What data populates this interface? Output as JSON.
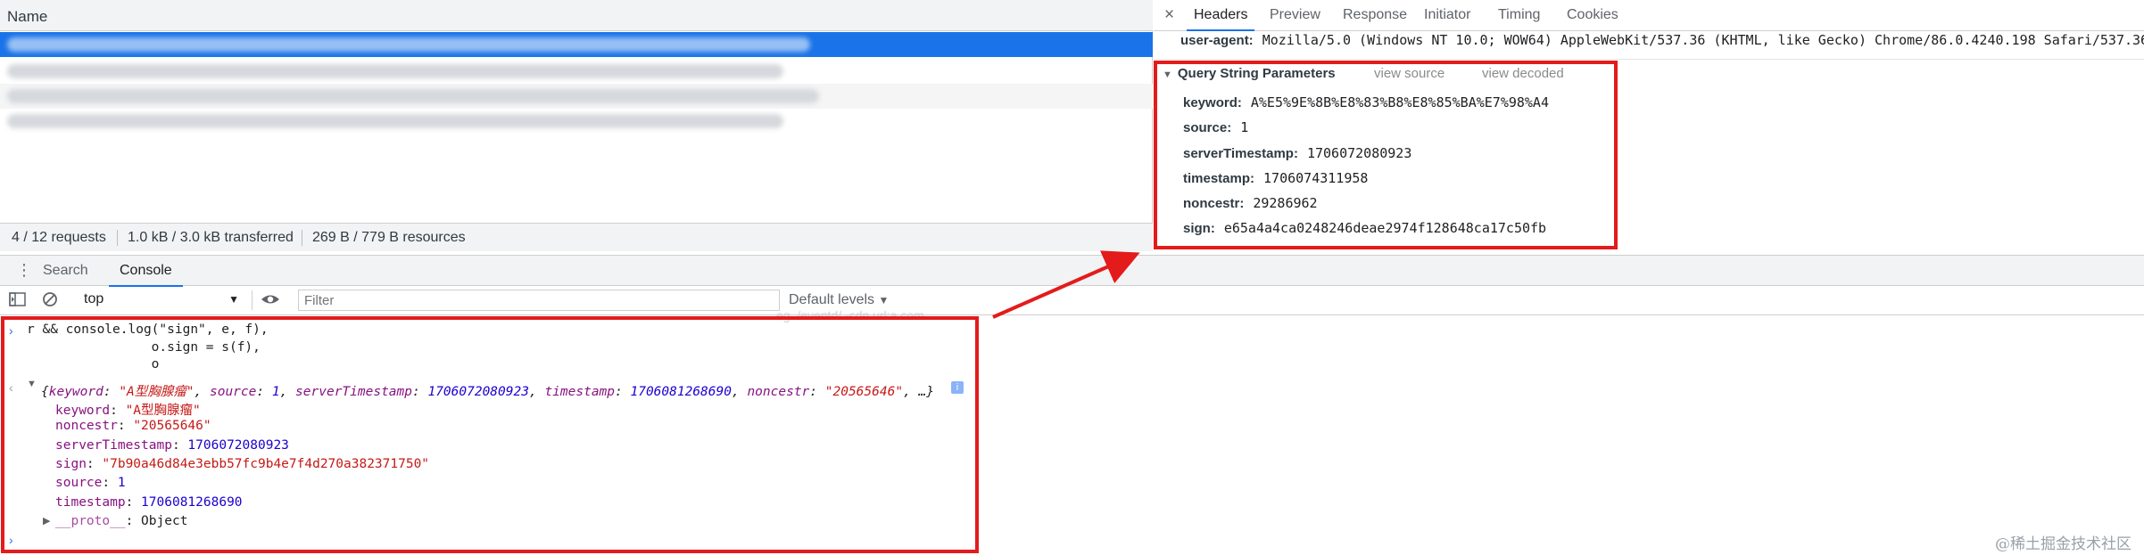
{
  "network": {
    "column_name": "Name",
    "status": {
      "requests": "4 / 12 requests",
      "transferred": "1.0 kB / 3.0 kB transferred",
      "resources": "269 B / 779 B resources"
    }
  },
  "headers_panel": {
    "close_glyph": "×",
    "tabs": [
      "Headers",
      "Preview",
      "Response",
      "Initiator",
      "Timing",
      "Cookies"
    ],
    "active_tab": "Headers",
    "user_agent": {
      "key": "user-agent:",
      "value": "Mozilla/5.0 (Windows NT 10.0; WOW64) AppleWebKit/537.36 (KHTML, like Gecko) Chrome/86.0.4240.198 Safari/537.36"
    },
    "query_string": {
      "title": "Query String Parameters",
      "view_source": "view source",
      "view_decoded": "view decoded",
      "params": [
        {
          "key": "keyword:",
          "value": "A%E5%9E%8B%E8%83%B8%E8%85%BA%E7%98%A4"
        },
        {
          "key": "source:",
          "value": "1"
        },
        {
          "key": "serverTimestamp:",
          "value": "1706072080923"
        },
        {
          "key": "timestamp:",
          "value": "1706074311958"
        },
        {
          "key": "noncestr:",
          "value": "29286962"
        },
        {
          "key": "sign:",
          "value": "e65a4a4ca0248246deae2974f128648ca17c50fb"
        }
      ]
    }
  },
  "drawer": {
    "tabs": [
      "Search",
      "Console"
    ],
    "active_tab": "Console",
    "toolbar": {
      "context": "top",
      "filter_placeholder": "Filter",
      "levels": "Default levels"
    }
  },
  "console": {
    "code_lines": [
      "r && console.log(\"sign\", e, f),",
      "                o.sign = s(f),",
      "                o"
    ],
    "summary": {
      "open": "{",
      "keyword_key": "keyword",
      "keyword_val": "\"A型胸腺瘤\"",
      "source_key": "source",
      "source_val": "1",
      "server_key": "serverTimestamp",
      "server_val": "1706072080923",
      "timestamp_key": "timestamp",
      "timestamp_val": "1706081268690",
      "noncestr_key": "noncestr",
      "noncestr_val": "\"20565646\"",
      "close": "…}"
    },
    "props": [
      {
        "key": "keyword",
        "value": "\"A型胸腺瘤\"",
        "kind": "str"
      },
      {
        "key": "noncestr",
        "value": "\"20565646\"",
        "kind": "str"
      },
      {
        "key": "serverTimestamp",
        "value": "1706072080923",
        "kind": "num"
      },
      {
        "key": "sign",
        "value": "\"7b90a46d84e3ebb57fc9b4e7f4d270a382371750\"",
        "kind": "str"
      },
      {
        "key": "source",
        "value": "1",
        "kind": "num"
      },
      {
        "key": "timestamp",
        "value": "1706081268690",
        "kind": "num"
      }
    ],
    "proto": {
      "key": "__proto__",
      "value": "Object"
    }
  },
  "watermark": "@稀土掘金技术社区",
  "colors": {
    "annotation_red": "#e41b1b",
    "selection_blue": "#1a73e8",
    "string_red": "#c41a16",
    "number_blue": "#1c00cf",
    "property_purple": "#881280"
  }
}
